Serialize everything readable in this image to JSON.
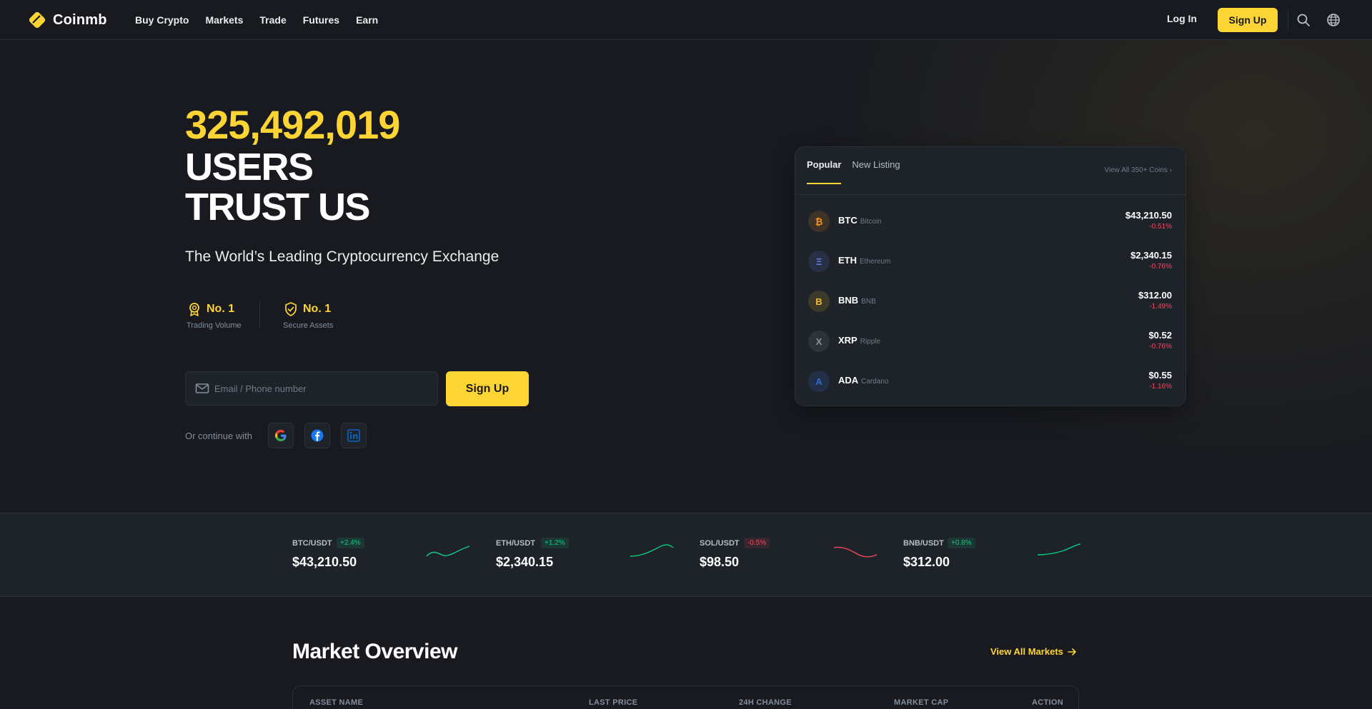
{
  "nav": {
    "brand": "Coinmb",
    "links": [
      "Buy Crypto",
      "Markets",
      "Trade",
      "Futures",
      "Earn"
    ],
    "login": "Log In",
    "signup": "Sign Up"
  },
  "hero": {
    "count": "325,492,019",
    "line1": "USERS",
    "line2": "TRUST US",
    "subtitle": "The World’s Leading Cryptocurrency Exchange",
    "awards": [
      {
        "title": "No. 1",
        "caption": "Trading Volume"
      },
      {
        "title": "No. 1",
        "caption": "Secure Assets"
      }
    ],
    "email_placeholder": "Email / Phone number",
    "signup": "Sign Up",
    "continue": "Or continue with"
  },
  "coins": {
    "tabs": [
      "Popular",
      "New Listing"
    ],
    "view_all": "View All 350+ Coins",
    "rows": [
      {
        "glyph": "₿",
        "symbol": "BTC",
        "name": "Bitcoin",
        "price": "$43,210.50",
        "change": "-0.51%",
        "color": "#f7931a"
      },
      {
        "glyph": "Ξ",
        "symbol": "ETH",
        "name": "Ethereum",
        "price": "$2,340.15",
        "change": "-0.76%",
        "color": "#627eea"
      },
      {
        "glyph": "B",
        "symbol": "BNB",
        "name": "BNB",
        "price": "$312.00",
        "change": "-1.49%",
        "color": "#f3ba2f"
      },
      {
        "glyph": "X",
        "symbol": "XRP",
        "name": "Ripple",
        "price": "$0.52",
        "change": "-0.76%",
        "color": "#8a939f"
      },
      {
        "glyph": "A",
        "symbol": "ADA",
        "name": "Cardano",
        "price": "$0.55",
        "change": "-1.16%",
        "color": "#3468d1"
      }
    ]
  },
  "ticker": [
    {
      "pair": "BTC/USDT",
      "pct": "+2.4%",
      "price": "$43,210.50",
      "dir": "up"
    },
    {
      "pair": "ETH/USDT",
      "pct": "+1.2%",
      "price": "$2,340.15",
      "dir": "up"
    },
    {
      "pair": "SOL/USDT",
      "pct": "-0.5%",
      "price": "$98.50",
      "dir": "down"
    },
    {
      "pair": "BNB/USDT",
      "pct": "+0.8%",
      "price": "$312.00",
      "dir": "up"
    }
  ],
  "market": {
    "title": "Market Overview",
    "view_all": "View All Markets",
    "headers": [
      "ASSET NAME",
      "LAST PRICE",
      "24H CHANGE",
      "MARKET CAP",
      "ACTION"
    ]
  },
  "colors": {
    "accent": "#fcd535",
    "up": "#0ecb81",
    "down": "#f6465d",
    "bg": "#181a20",
    "panel": "#1e2329"
  }
}
